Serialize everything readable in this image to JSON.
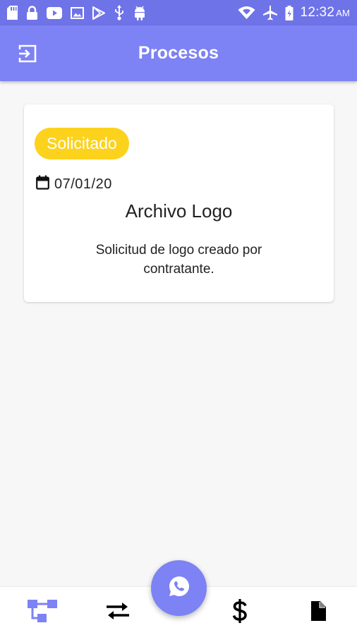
{
  "status_bar": {
    "time": "12:32",
    "ampm": "AM",
    "left_icons": [
      "sd-card-icon",
      "lock-icon",
      "youtube-icon",
      "image-icon",
      "play-store-icon",
      "usb-icon",
      "android-icon"
    ],
    "right_icons": [
      "wifi-icon",
      "airplane-icon",
      "battery-icon"
    ]
  },
  "app_bar": {
    "title": "Procesos",
    "exit_icon": "exit-icon"
  },
  "card": {
    "status": "Solicitado",
    "date": "07/01/20",
    "title": "Archivo Logo",
    "description": "Solicitud de logo creado por contratante."
  },
  "bottom_nav": {
    "items": [
      "processes-icon",
      "transfer-icon",
      "dollar-icon",
      "document-icon"
    ],
    "fab_icon": "whatsapp-icon"
  },
  "colors": {
    "status_bar": "#6f73e8",
    "primary": "#7d82f4",
    "badge": "#fcd21d",
    "background": "#f7f7f7"
  }
}
